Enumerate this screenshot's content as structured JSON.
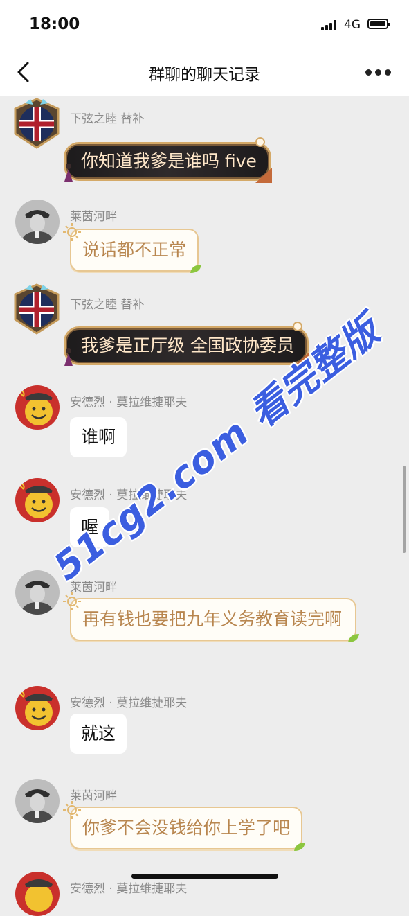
{
  "status_bar": {
    "time": "18:00",
    "network": "4G"
  },
  "nav": {
    "title": "群聊的聊天记录"
  },
  "messages": [
    {
      "sender": "下弦之睦 替补",
      "text": "你知道我爹是谁吗 five",
      "avatar": "union-jack-badge-icon",
      "style": "dark"
    },
    {
      "sender": "莱茵河畔",
      "text": "说话都不正常",
      "avatar": "soldier-portrait-icon",
      "style": "gold"
    },
    {
      "sender": "下弦之睦 替补",
      "text": "我爹是正厅级 全国政协委员",
      "avatar": "union-jack-badge-icon",
      "style": "dark"
    },
    {
      "sender": "安德烈 · 莫拉维捷耶夫",
      "text": "谁啊",
      "avatar": "smiley-soviet-icon",
      "style": "plain"
    },
    {
      "sender": "安德烈 · 莫拉维捷耶夫",
      "text": "喔",
      "avatar": "smiley-soviet-icon",
      "style": "plain"
    },
    {
      "sender": "莱茵河畔",
      "text": "再有钱也要把九年义务教育读完啊",
      "avatar": "soldier-portrait-icon",
      "style": "gold"
    },
    {
      "sender": "安德烈 · 莫拉维捷耶夫",
      "text": "就这",
      "avatar": "smiley-soviet-icon",
      "style": "plain"
    },
    {
      "sender": "莱茵河畔",
      "text": "你爹不会没钱给你上学了吧",
      "avatar": "soldier-portrait-icon",
      "style": "gold"
    },
    {
      "sender": "安德烈 · 莫拉维捷耶夫",
      "text": "",
      "avatar": "smiley-soviet-icon",
      "style": "plain"
    }
  ],
  "watermark": "51cg2.com 看完整版",
  "colors": {
    "background": "#ededed",
    "gold_text": "#b8864f",
    "dark_bubble_text": "#ffe7c9",
    "watermark": "#3b5ee0"
  }
}
